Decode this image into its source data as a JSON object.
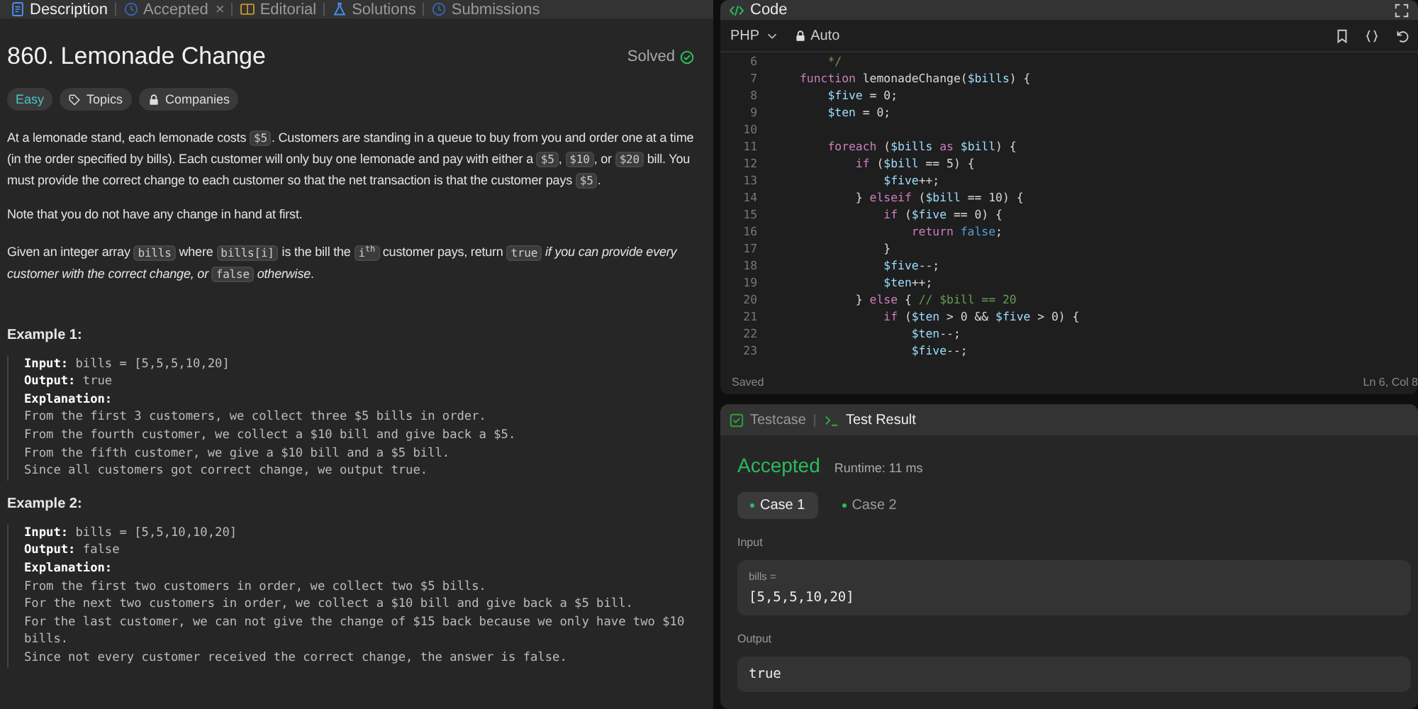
{
  "tabs": [
    {
      "label": "Description",
      "selected": true
    },
    {
      "label": "Accepted",
      "selected": false,
      "close": "×"
    },
    {
      "label": "Editorial",
      "selected": false
    },
    {
      "label": "Solutions",
      "selected": false
    },
    {
      "label": "Submissions",
      "selected": false
    }
  ],
  "problem": {
    "title": "860. Lemonade Change",
    "status": "Solved",
    "tags": [
      {
        "label": "Easy",
        "kind": "difficulty"
      },
      {
        "label": "Topics",
        "kind": "tag"
      },
      {
        "label": "Companies",
        "kind": "lock"
      }
    ],
    "paragraphs": [
      [
        {
          "kind": "text",
          "text": "At a lemonade stand, each lemonade costs "
        },
        {
          "kind": "code",
          "text": "$5"
        },
        {
          "kind": "text",
          "text": ". Customers are standing in a queue to buy from you and order one at a time (in the order specified by bills). Each customer will only buy one lemonade and pay with either a "
        },
        {
          "kind": "code",
          "text": "$5"
        },
        {
          "kind": "text",
          "text": ", "
        },
        {
          "kind": "code",
          "text": "$10"
        },
        {
          "kind": "text",
          "text": ", or "
        },
        {
          "kind": "code",
          "text": "$20"
        },
        {
          "kind": "text",
          "text": " bill. You must provide the correct change to each customer so that the net transaction is that the customer pays "
        },
        {
          "kind": "code",
          "text": "$5"
        },
        {
          "kind": "text",
          "text": "."
        }
      ],
      [
        {
          "kind": "text",
          "text": "Note that you do not have any change in hand at first."
        }
      ],
      [
        {
          "kind": "text",
          "text": "Given an integer array "
        },
        {
          "kind": "code",
          "text": "bills"
        },
        {
          "kind": "text",
          "text": " where "
        },
        {
          "kind": "code",
          "text": "bills[i]"
        },
        {
          "kind": "text",
          "text": " is the bill the "
        },
        {
          "kind": "code",
          "text": "i$^{th}$"
        },
        {
          "kind": "text",
          "text": " customer pays, return "
        },
        {
          "kind": "code",
          "text": "true"
        },
        {
          "kind": "text",
          "text": " *if you can provide every customer with the correct change, or* "
        },
        {
          "kind": "code",
          "text": "false"
        },
        {
          "kind": "text",
          "text": " *otherwise*."
        }
      ]
    ],
    "examples": [
      {
        "title": "Example 1:",
        "lines": [
          "**Input:** bills = [5,5,5,10,20]",
          "**Output:** true",
          "**Explanation:**",
          "From the first 3 customers, we collect three $5 bills in order.",
          "From the fourth customer, we collect a $10 bill and give back a $5.",
          "From the fifth customer, we give a $10 bill and a $5 bill.",
          "Since all customers got correct change, we output true."
        ]
      },
      {
        "title": "Example 2:",
        "lines": [
          "**Input:** bills = [5,5,10,10,20]",
          "**Output:** false",
          "**Explanation:**",
          "From the first two customers in order, we collect two $5 bills.",
          "For the next two customers in order, we collect a $10 bill and give back a $5 bill.",
          "For the last customer, we can not give the change of $15 back because we only have two $10 bills.",
          "Since not every customer received the correct change, the answer is false."
        ]
      }
    ]
  },
  "editor": {
    "title": "Code",
    "language": "PHP",
    "mode": "Auto",
    "status": "Saved",
    "cursor": "Ln 6, Col 8",
    "lines": [
      {
        "no": "6",
        "tokens": [
          {
            "kind": "comment",
            "text": "    */"
          }
        ]
      },
      {
        "no": "7",
        "tokens": [
          {
            "kind": "keyword",
            "text": "function"
          },
          {
            "kind": "plain",
            "text": " lemonadeChange("
          },
          {
            "kind": "var",
            "text": "$bills"
          },
          {
            "kind": "plain",
            "text": ") {"
          }
        ]
      },
      {
        "no": "8",
        "tokens": [
          {
            "kind": "var",
            "text": "    $five"
          },
          {
            "kind": "plain",
            "text": " = 0;"
          }
        ]
      },
      {
        "no": "9",
        "tokens": [
          {
            "kind": "var",
            "text": "    $ten"
          },
          {
            "kind": "plain",
            "text": " = 0;"
          }
        ]
      },
      {
        "no": "10"
      },
      {
        "no": "11",
        "tokens": [
          {
            "kind": "keyword",
            "text": "    foreach"
          },
          {
            "kind": "plain",
            "text": " ("
          },
          {
            "kind": "var",
            "text": "$bills"
          },
          {
            "kind": "keyword",
            "text": " as "
          },
          {
            "kind": "var",
            "text": "$bill"
          },
          {
            "kind": "plain",
            "text": ") {"
          }
        ]
      },
      {
        "no": "12",
        "tokens": [
          {
            "kind": "keyword",
            "text": "        if"
          },
          {
            "kind": "plain",
            "text": " ("
          },
          {
            "kind": "var",
            "text": "$bill"
          },
          {
            "kind": "plain",
            "text": " == 5) {"
          }
        ]
      },
      {
        "no": "13",
        "tokens": [
          {
            "kind": "var",
            "text": "            $five"
          },
          {
            "kind": "plain",
            "text": "++;"
          }
        ]
      },
      {
        "no": "14",
        "tokens": [
          {
            "kind": "plain",
            "text": "        } "
          },
          {
            "kind": "keyword",
            "text": "elseif"
          },
          {
            "kind": "plain",
            "text": " ("
          },
          {
            "kind": "var",
            "text": "$bill"
          },
          {
            "kind": "plain",
            "text": " == 10) {"
          }
        ]
      },
      {
        "no": "15",
        "tokens": [
          {
            "kind": "keyword",
            "text": "            if"
          },
          {
            "kind": "plain",
            "text": " ("
          },
          {
            "kind": "var",
            "text": "$five"
          },
          {
            "kind": "plain",
            "text": " == 0) {"
          }
        ]
      },
      {
        "no": "16",
        "tokens": [
          {
            "kind": "keyword",
            "text": "                return"
          },
          {
            "kind": "const",
            "text": " false"
          },
          {
            "kind": "plain",
            "text": ";"
          }
        ]
      },
      {
        "no": "17",
        "tokens": [
          {
            "kind": "plain",
            "text": "            }"
          }
        ]
      },
      {
        "no": "18",
        "tokens": [
          {
            "kind": "var",
            "text": "            $five"
          },
          {
            "kind": "plain",
            "text": "--;"
          }
        ]
      },
      {
        "no": "19",
        "tokens": [
          {
            "kind": "var",
            "text": "            $ten"
          },
          {
            "kind": "plain",
            "text": "++;"
          }
        ]
      },
      {
        "no": "20",
        "tokens": [
          {
            "kind": "plain",
            "text": "        } "
          },
          {
            "kind": "keyword",
            "text": "else"
          },
          {
            "kind": "plain",
            "text": " { "
          },
          {
            "kind": "comment",
            "text": "// $bill == 20"
          }
        ]
      },
      {
        "no": "21",
        "tokens": [
          {
            "kind": "keyword",
            "text": "            if"
          },
          {
            "kind": "plain",
            "text": " ("
          },
          {
            "kind": "var",
            "text": "$ten"
          },
          {
            "kind": "plain",
            "text": " > 0 && "
          },
          {
            "kind": "var",
            "text": "$five"
          },
          {
            "kind": "plain",
            "text": " > 0) {"
          }
        ]
      },
      {
        "no": "22",
        "tokens": [
          {
            "kind": "var",
            "text": "                $ten"
          },
          {
            "kind": "plain",
            "text": "--;"
          }
        ]
      },
      {
        "no": "23",
        "tokens": [
          {
            "kind": "var",
            "text": "                $five"
          },
          {
            "kind": "plain",
            "text": "--;"
          }
        ]
      }
    ]
  },
  "results": {
    "tabs": [
      {
        "label": "Testcase",
        "selected": false
      },
      {
        "label": "Test Result",
        "selected": true
      }
    ],
    "verdict": "Accepted",
    "runtime": "Runtime: 11 ms",
    "cases": [
      {
        "label": "Case 1",
        "selected": true
      },
      {
        "label": "Case 2",
        "selected": false
      }
    ],
    "input_label": "Input",
    "inputs": [
      {
        "name": "bills =",
        "value": "[5,5,5,10,20]"
      }
    ],
    "output_label": "Output",
    "output": "true"
  }
}
